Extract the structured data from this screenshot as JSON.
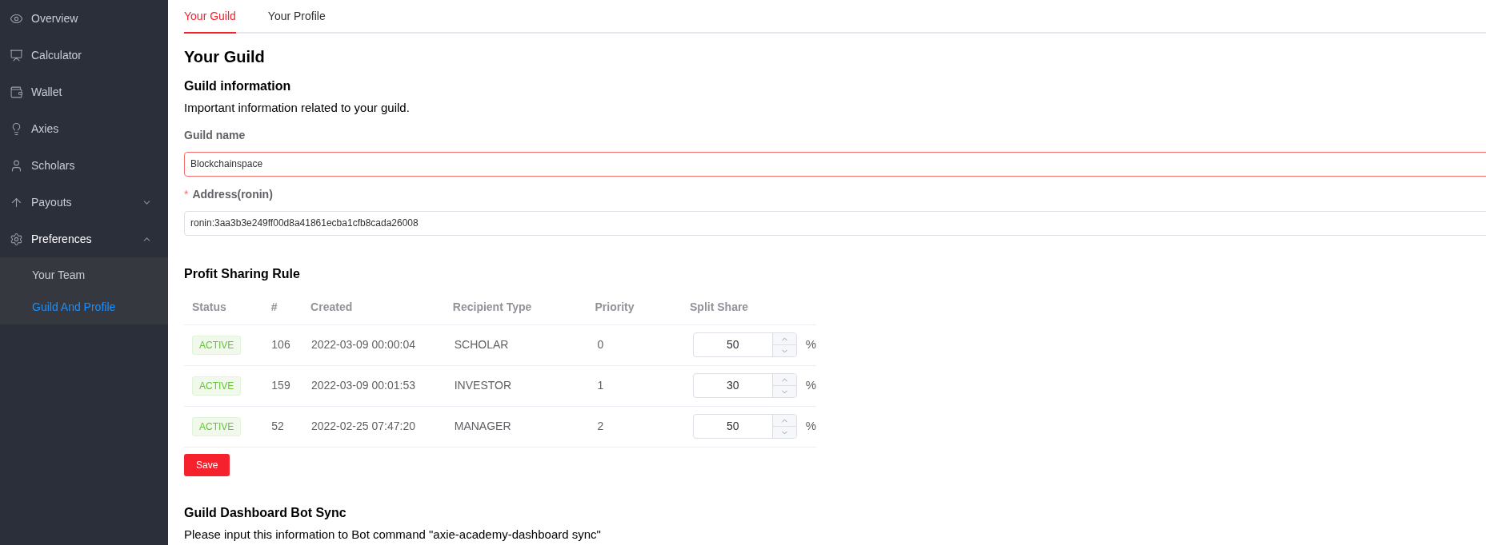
{
  "sidebar": {
    "items": [
      {
        "label": "Overview",
        "selected": false
      },
      {
        "label": "Calculator",
        "selected": false
      },
      {
        "label": "Wallet",
        "selected": false
      },
      {
        "label": "Axies",
        "selected": false
      },
      {
        "label": "Scholars",
        "selected": false
      },
      {
        "label": "Payouts",
        "selected": false,
        "expanded": false
      },
      {
        "label": "Preferences",
        "selected": false,
        "expanded": true,
        "children": [
          {
            "label": "Your Team",
            "selected": false
          },
          {
            "label": "Guild And Profile",
            "selected": true
          }
        ]
      }
    ]
  },
  "tabs": [
    {
      "label": "Your Guild",
      "selected": true
    },
    {
      "label": "Your Profile",
      "selected": false
    }
  ],
  "page_title": "Your Guild",
  "guild_info": {
    "title": "Guild information",
    "description": "Important information related to your guild.",
    "fields": [
      {
        "label": "Guild name",
        "value": "Blockchainspace",
        "error": true
      },
      {
        "required_mark": "*",
        "label": "Address(ronin)",
        "value": "ronin:3aa3b3e249ff00d8a41861ecba1cfb8cada26008",
        "error": false
      }
    ]
  },
  "profit_sharing": {
    "title": "Profit Sharing Rule",
    "columns": [
      "Status",
      "#",
      "Created",
      "Recipient Type",
      "Priority",
      "Split Share"
    ],
    "rows": [
      {
        "status": "ACTIVE",
        "id": "106",
        "created": "2022-03-09 00:00:04",
        "recipient_type": "SCHOLAR",
        "priority": "0",
        "split_share": "50",
        "unit": "%"
      },
      {
        "status": "ACTIVE",
        "id": "159",
        "created": "2022-03-09 00:01:53",
        "recipient_type": "INVESTOR",
        "priority": "1",
        "split_share": "30",
        "unit": "%"
      },
      {
        "status": "ACTIVE",
        "id": "52",
        "created": "2022-02-25 07:47:20",
        "recipient_type": "MANAGER",
        "priority": "2",
        "split_share": "50",
        "unit": "%"
      }
    ],
    "save_button": "Save"
  },
  "bot_sync": {
    "title": "Guild Dashboard Bot Sync",
    "description": "Please input this information to Bot command \"axie-academy-dashboard sync\""
  }
}
